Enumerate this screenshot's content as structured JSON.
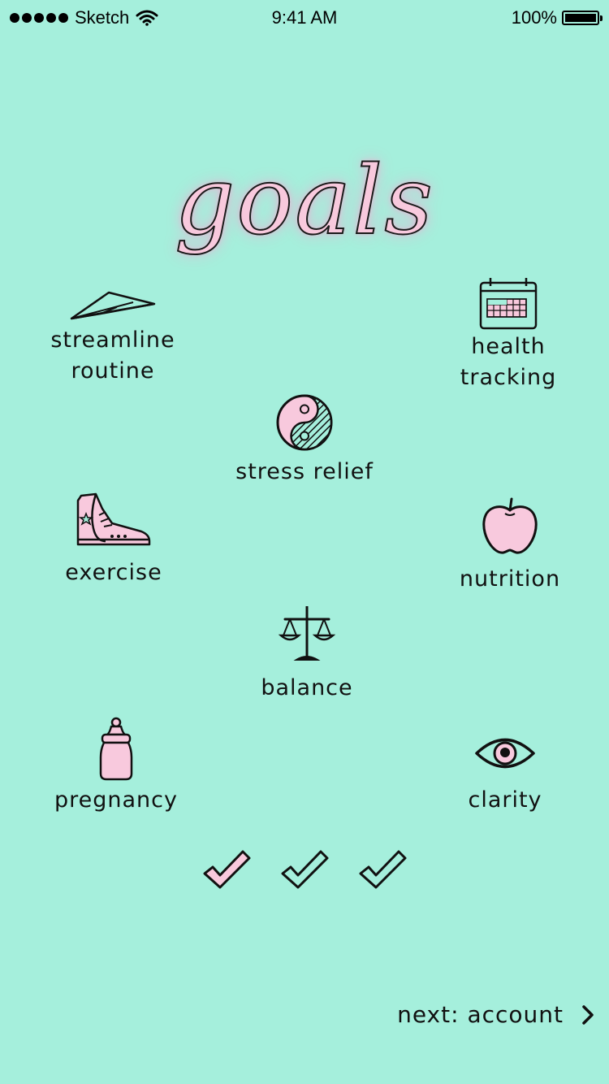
{
  "status_bar": {
    "carrier": "Sketch",
    "time": "9:41 AM",
    "battery": "100%"
  },
  "title": "goals",
  "goals": {
    "streamline": {
      "label": "streamline\nroutine",
      "icon": "paper-plane-icon"
    },
    "health": {
      "label": "health\ntracking",
      "icon": "calendar-icon"
    },
    "stress": {
      "label": "stress relief",
      "icon": "yin-yang-icon"
    },
    "exercise": {
      "label": "exercise",
      "icon": "sneaker-icon"
    },
    "nutrition": {
      "label": "nutrition",
      "icon": "apple-icon"
    },
    "balance": {
      "label": "balance",
      "icon": "scale-icon"
    },
    "pregnancy": {
      "label": "pregnancy",
      "icon": "baby-bottle-icon"
    },
    "clarity": {
      "label": "clarity",
      "icon": "eye-icon"
    }
  },
  "progress": {
    "steps": 3,
    "filled": 1
  },
  "footer": {
    "next_label": "next: account",
    "next_icon": "chevron-right-icon"
  },
  "colors": {
    "background": "#a5efdc",
    "accent_pink": "#f8c9dd",
    "ink": "#111111"
  }
}
